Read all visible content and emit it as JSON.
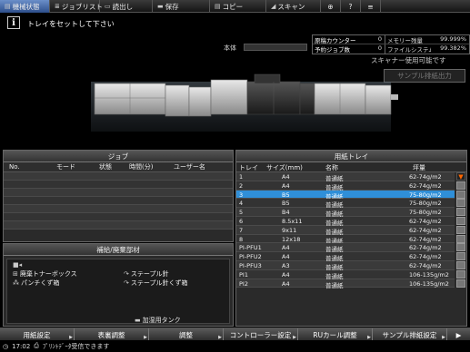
{
  "tabs": [
    {
      "label": "機械状態",
      "icon": "machine-icon",
      "active": true
    },
    {
      "label": "ジョブリスト",
      "icon": "list-icon",
      "active": false
    },
    {
      "label": "読出し",
      "icon": "folder-icon",
      "active": false
    },
    {
      "label": "保存",
      "icon": "save-icon",
      "active": false
    },
    {
      "label": "コピー",
      "icon": "copy-icon",
      "active": false
    },
    {
      "label": "スキャン",
      "icon": "scan-icon",
      "active": false
    }
  ],
  "message": "トレイをセットして下さい",
  "body_label": "本体",
  "counters": [
    {
      "label": "原稿カウンター",
      "value": "0",
      "label2": "メモリー残量",
      "value2": "99.999%"
    },
    {
      "label": "予約ジョブ数",
      "value": "0",
      "label2": "ファイルシステム残量",
      "value2": "99.382%"
    }
  ],
  "scan_status": "スキャナー使用可能です",
  "sample_output_label": "サンプル排紙出力",
  "job_panel": {
    "title": "ジョブ",
    "columns": [
      "No.",
      "モード",
      "状態",
      "時間(分)",
      "ユーザー名"
    ],
    "rows": 7
  },
  "consumables": {
    "title": "補給/廃棄部材",
    "items": [
      "廃棄トナーボックス",
      "パンチくず箱",
      "ステープル針",
      "ステープル針くず箱",
      "加湿用タンク"
    ]
  },
  "tray_panel": {
    "title": "用紙トレイ",
    "columns": [
      "トレイ",
      "サイズ(mm)",
      "名称",
      "坪量"
    ],
    "rows": [
      {
        "tray": "1",
        "size": "A4",
        "name": "普通紙",
        "weight": "62-74g/m2",
        "selected": false,
        "warn": true
      },
      {
        "tray": "2",
        "size": "A4",
        "name": "普通紙",
        "weight": "62-74g/m2",
        "selected": false,
        "warn": false
      },
      {
        "tray": "3",
        "size": "B5",
        "name": "普通紙",
        "weight": "75-80g/m2",
        "selected": true,
        "warn": false
      },
      {
        "tray": "4",
        "size": "B5",
        "name": "普通紙",
        "weight": "75-80g/m2",
        "selected": false,
        "warn": false
      },
      {
        "tray": "5",
        "size": "B4",
        "name": "普通紙",
        "weight": "75-80g/m2",
        "selected": false,
        "warn": false
      },
      {
        "tray": "6",
        "size": "8.5x11",
        "name": "普通紙",
        "weight": "62-74g/m2",
        "selected": false,
        "warn": false
      },
      {
        "tray": "7",
        "size": "9x11",
        "name": "普通紙",
        "weight": "62-74g/m2",
        "selected": false,
        "warn": false
      },
      {
        "tray": "8",
        "size": "12x18",
        "name": "普通紙",
        "weight": "62-74g/m2",
        "selected": false,
        "warn": false
      },
      {
        "tray": "PI-PFU1",
        "size": "A4",
        "name": "普通紙",
        "weight": "62-74g/m2",
        "selected": false,
        "warn": false
      },
      {
        "tray": "PI-PFU2",
        "size": "A4",
        "name": "普通紙",
        "weight": "62-74g/m2",
        "selected": false,
        "warn": false
      },
      {
        "tray": "PI-PFU3",
        "size": "A3",
        "name": "普通紙",
        "weight": "62-74g/m2",
        "selected": false,
        "warn": false
      },
      {
        "tray": "PI1",
        "size": "A4",
        "name": "普通紙",
        "weight": "106-135g/m2",
        "selected": false,
        "warn": false
      },
      {
        "tray": "PI2",
        "size": "A4",
        "name": "普通紙",
        "weight": "106-135g/m2",
        "selected": false,
        "warn": false
      }
    ]
  },
  "bottom_buttons": [
    "用紙設定",
    "表裏調整",
    "調整",
    "コントローラー設定",
    "RUカール調整",
    "サンプル排紙設定"
  ],
  "status_time": "17:02",
  "status_text": "ﾌﾟﾘﾝﾄﾃﾞｰﾀ受信できます",
  "colors": {
    "accent": "#2f8fd8",
    "tab_active": "#4a6fb0",
    "warning": "#ff6600"
  }
}
